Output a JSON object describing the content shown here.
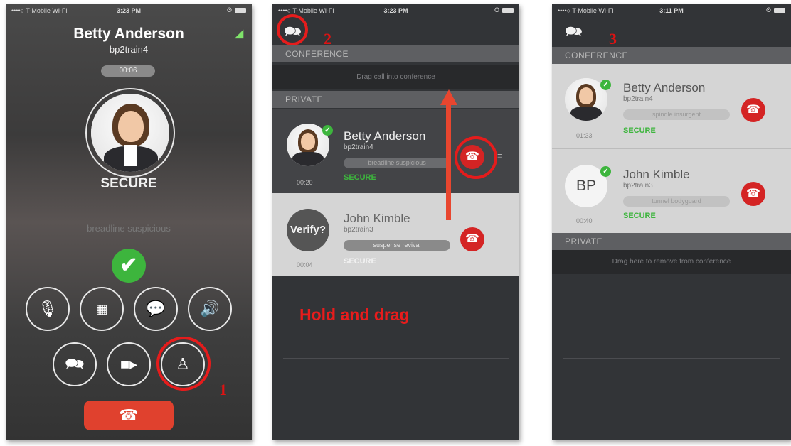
{
  "status_bars": [
    {
      "carrier": "••••○ T-Mobile Wi-Fi",
      "time": "3:23 PM"
    },
    {
      "carrier": "••••○ T-Mobile Wi-Fi",
      "time": "3:23 PM"
    },
    {
      "carrier": "••••○ T-Mobile Wi-Fi",
      "time": "3:11 PM"
    }
  ],
  "call_screen": {
    "name": "Betty Anderson",
    "username": "bp2train4",
    "timer": "00:06",
    "status": "SECURE",
    "verify_words": "breadline  suspicious",
    "buttons": [
      {
        "name": "mute",
        "icon": "mic-off-icon"
      },
      {
        "name": "keypad",
        "icon": "keypad-icon"
      },
      {
        "name": "chat",
        "icon": "chat-icon"
      },
      {
        "name": "speaker",
        "icon": "speaker-icon"
      },
      {
        "name": "conversations",
        "icon": "conversations-icon"
      },
      {
        "name": "video",
        "icon": "video-icon"
      },
      {
        "name": "conference",
        "icon": "conference-icon"
      }
    ]
  },
  "conference_screen": {
    "conference_header": "CONFERENCE",
    "drop_hint": "Drag call into conference",
    "private_header": "PRIVATE",
    "calls": [
      {
        "name": "Betty Anderson",
        "username": "bp2train4",
        "words": "breadline  suspicious",
        "status": "SECURE",
        "time": "00:20"
      },
      {
        "name": "John Kimble",
        "username": "bp2train3",
        "words": "suspense  revival",
        "status": "SECURE",
        "time": "00:04",
        "avatar_text": "Verify?"
      }
    ],
    "instruction": "Hold and drag"
  },
  "conference_result": {
    "conference_header": "CONFERENCE",
    "private_header": "PRIVATE",
    "drop_hint": "Drag here to remove from conference",
    "calls": [
      {
        "name": "Betty Anderson",
        "username": "bp2train4",
        "words": "spindle  insurgent",
        "status": "SECURE",
        "time": "01:33"
      },
      {
        "name": "John Kimble",
        "username": "bp2train3",
        "words": "tunnel  bodyguard",
        "status": "SECURE",
        "time": "00:40",
        "avatar_text": "BP"
      }
    ]
  },
  "annotations": [
    "1",
    "2",
    "3"
  ],
  "colors": {
    "accent_red": "#e51c1c",
    "secure_green": "#3db53d",
    "end_call_red": "#e0412e"
  }
}
